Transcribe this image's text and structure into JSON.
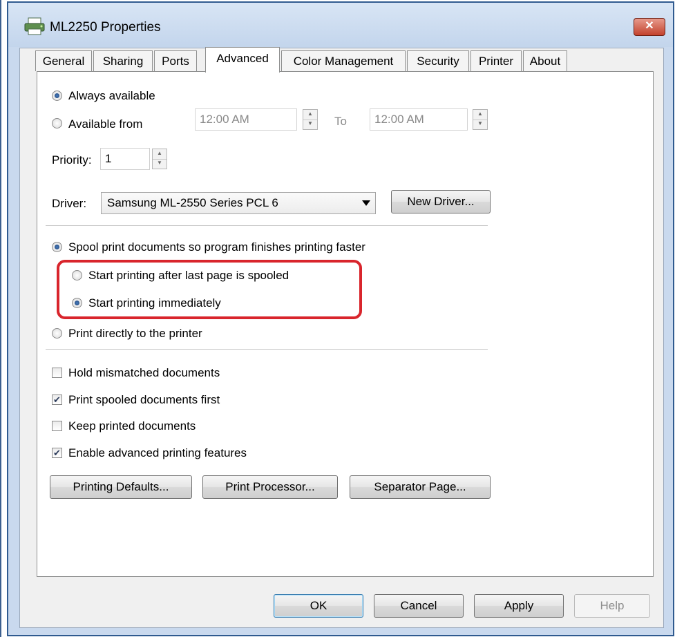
{
  "window": {
    "title": "ML2250 Properties",
    "close_glyph": "✕"
  },
  "tabs": [
    {
      "label": "General"
    },
    {
      "label": "Sharing"
    },
    {
      "label": "Ports"
    },
    {
      "label": "Advanced",
      "active": true
    },
    {
      "label": "Color Management"
    },
    {
      "label": "Security"
    },
    {
      "label": "Printer"
    },
    {
      "label": "About"
    }
  ],
  "availability": {
    "always_label": "Always available",
    "from_label": "Available from",
    "from_time": "12:00 AM",
    "to_label": "To",
    "to_time": "12:00 AM",
    "selected": "always"
  },
  "priority": {
    "label": "Priority:",
    "value": "1"
  },
  "driver": {
    "label": "Driver:",
    "value": "Samsung ML-2550 Series PCL 6",
    "new_driver_button": "New Driver..."
  },
  "spooling": {
    "spool_label": "Spool print documents so program finishes printing faster",
    "after_last_label": "Start printing after last page is spooled",
    "immediately_label": "Start printing immediately",
    "direct_label": "Print directly to the printer",
    "selected_mode": "spool",
    "selected_start": "immediately"
  },
  "options": [
    {
      "label": "Hold mismatched documents",
      "checked": false
    },
    {
      "label": "Print spooled documents first",
      "checked": true
    },
    {
      "label": "Keep printed documents",
      "checked": false
    },
    {
      "label": "Enable advanced printing features",
      "checked": true
    }
  ],
  "action_buttons": {
    "printing_defaults": "Printing Defaults...",
    "print_processor": "Print Processor...",
    "separator_page": "Separator Page..."
  },
  "footer": {
    "ok": "OK",
    "cancel": "Cancel",
    "apply": "Apply",
    "help": "Help"
  },
  "colors": {
    "highlight": "#d9252c",
    "titlebar": "#c9d9ee",
    "accent": "#3c7fb1"
  }
}
